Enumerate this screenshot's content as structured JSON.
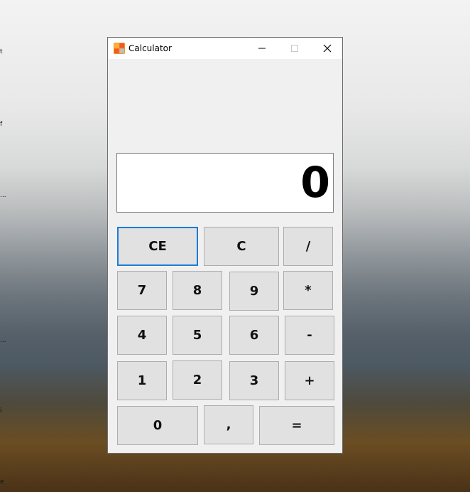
{
  "window": {
    "title": "Calculator",
    "minimize_glyph": "minimize",
    "maximize_glyph": "maximize",
    "close_glyph": "close"
  },
  "display": {
    "value": "0"
  },
  "buttons": {
    "ce": "CE",
    "c": "C",
    "divide": "/",
    "seven": "7",
    "eight": "8",
    "nine": "9",
    "multiply": "*",
    "four": "4",
    "five": "5",
    "six": "6",
    "minus": "-",
    "one": "1",
    "two": "2",
    "three": "3",
    "plus": "+",
    "zero": "0",
    "comma": ",",
    "equals": "="
  },
  "desktop": {
    "icon_fragments": [
      "t",
      "f",
      "...",
      "...",
      "i",
      "e"
    ]
  },
  "colors": {
    "focus_border": "#1c7cd5",
    "button_bg": "#e1e1e1",
    "window_bg": "#f0f0f0"
  }
}
